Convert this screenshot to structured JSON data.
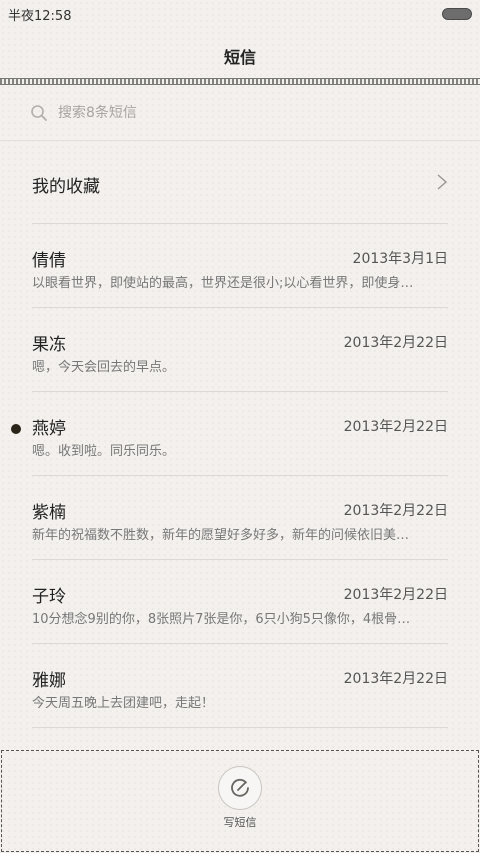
{
  "status_bar": {
    "time": "半夜12:58"
  },
  "header": {
    "title": "短信"
  },
  "search": {
    "placeholder": "搜索8条短信"
  },
  "favorites": {
    "label": "我的收藏"
  },
  "messages": [
    {
      "name": "倩倩",
      "date": "2013年3月1日",
      "preview": "以眼看世界，即使站的最高，世界还是很小;以心看世界，即使身…",
      "unread": false
    },
    {
      "name": "果冻",
      "date": "2013年2月22日",
      "preview": "嗯，今天会回去的早点。",
      "unread": false
    },
    {
      "name": "燕婷",
      "date": "2013年2月22日",
      "preview": "嗯。收到啦。同乐同乐。",
      "unread": true
    },
    {
      "name": "紫楠",
      "date": "2013年2月22日",
      "preview": "新年的祝福数不胜数，新年的愿望好多好多，新年的问候依旧美…",
      "unread": false
    },
    {
      "name": "子玲",
      "date": "2013年2月22日",
      "preview": "10分想念9别的你，8张照片7张是你，6只小狗5只像你，4根骨…",
      "unread": false
    },
    {
      "name": "雅娜",
      "date": "2013年2月22日",
      "preview": "今天周五晚上去团建吧，走起！",
      "unread": false
    }
  ],
  "compose": {
    "label": "写短信"
  },
  "icons": {
    "search": "search-icon",
    "chevron": "chevron-right-icon",
    "compose": "compose-icon",
    "battery": "battery-icon"
  }
}
